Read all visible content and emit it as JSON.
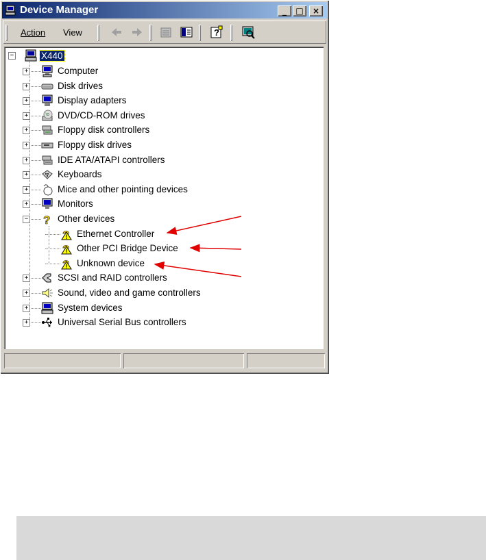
{
  "window": {
    "title": "Device Manager",
    "controls": {
      "minimize": "_",
      "maximize": "□",
      "close": "×"
    }
  },
  "menu": {
    "action": "Action",
    "view": "View"
  },
  "toolbar_icons": [
    "back-arrow-icon",
    "forward-arrow-icon",
    "properties-icon",
    "show-hide-tree-icon",
    "help-icon",
    "scan-hardware-icon"
  ],
  "tree": {
    "root": "X440",
    "categories": [
      {
        "label": "Computer",
        "icon": "computer-icon"
      },
      {
        "label": "Disk drives",
        "icon": "disk-drive-icon"
      },
      {
        "label": "Display adapters",
        "icon": "display-adapter-icon"
      },
      {
        "label": "DVD/CD-ROM drives",
        "icon": "cdrom-icon"
      },
      {
        "label": "Floppy disk controllers",
        "icon": "floppy-controller-icon"
      },
      {
        "label": "Floppy disk drives",
        "icon": "floppy-drive-icon"
      },
      {
        "label": "IDE ATA/ATAPI controllers",
        "icon": "ide-controller-icon"
      },
      {
        "label": "Keyboards",
        "icon": "keyboard-icon"
      },
      {
        "label": "Mice and other pointing devices",
        "icon": "mouse-icon"
      },
      {
        "label": "Monitors",
        "icon": "monitor-icon"
      },
      {
        "label": "Other devices",
        "icon": "question-mark-icon",
        "expanded": true,
        "children": [
          {
            "label": "Ethernet Controller",
            "icon": "warning-device-icon"
          },
          {
            "label": "Other PCI Bridge Device",
            "icon": "warning-device-icon"
          },
          {
            "label": "Unknown device",
            "icon": "warning-device-icon"
          }
        ]
      },
      {
        "label": "SCSI and RAID controllers",
        "icon": "scsi-icon"
      },
      {
        "label": "Sound, video and game controllers",
        "icon": "sound-icon"
      },
      {
        "label": "System devices",
        "icon": "system-devices-icon"
      },
      {
        "label": "Universal Serial Bus controllers",
        "icon": "usb-icon"
      }
    ]
  },
  "annotation_color": "#e00000",
  "status_bar": [
    "",
    "",
    ""
  ]
}
